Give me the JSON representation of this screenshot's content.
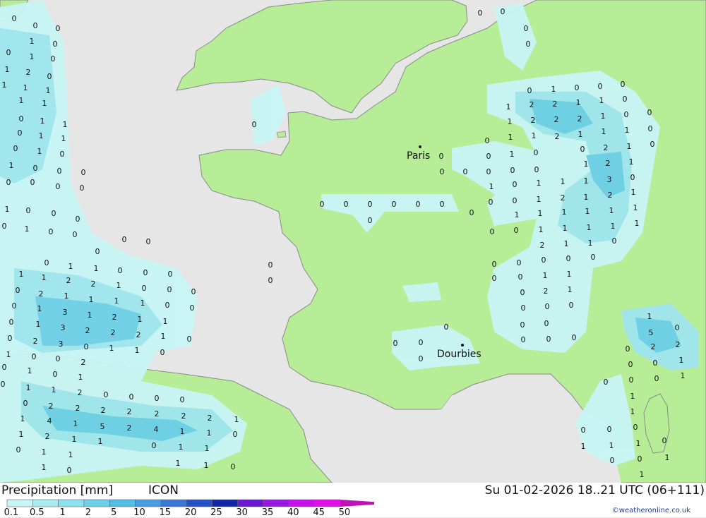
{
  "header": {
    "title": "Precipitation [mm]",
    "model": "ICON",
    "valid_time": "Su 01-02-2026 18..21 UTC (06+111)"
  },
  "legend": {
    "ticks": [
      "0.1",
      "0.5",
      "1",
      "2",
      "5",
      "10",
      "15",
      "20",
      "25",
      "30",
      "35",
      "40",
      "45",
      "50"
    ],
    "colors": [
      "#c8f5f5",
      "#a8ecf2",
      "#8ce2ee",
      "#6cd2ea",
      "#54bde6",
      "#4a9de0",
      "#3a78d8",
      "#2450c8",
      "#1026a8",
      "#6a16d2",
      "#9a16e2",
      "#c810ee",
      "#e40ee6",
      "#c010b8"
    ]
  },
  "credit": "©weatheronline.co.uk",
  "cities": [
    {
      "name": "Paris"
    },
    {
      "name": "Dourbies"
    }
  ],
  "colors": {
    "sea": "#e6e6e6",
    "land": "#b8ed98",
    "precip_light": "#c8f5f5",
    "precip_mid": "#9ee5ee",
    "precip_heavy": "#6ccfe8"
  },
  "map_values": [
    "0",
    "1",
    "2",
    "3",
    "4",
    "5"
  ]
}
